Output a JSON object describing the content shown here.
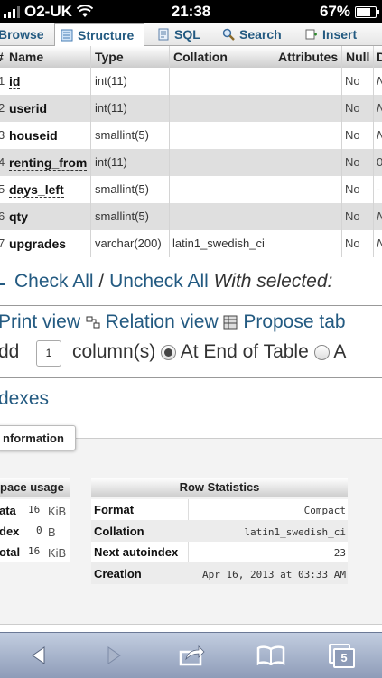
{
  "status": {
    "carrier": "O2-UK",
    "time": "21:38",
    "battery": "67%"
  },
  "tabs": [
    {
      "label": "Browse",
      "icon": "browse-icon"
    },
    {
      "label": "Structure",
      "icon": "structure-icon",
      "active": true
    },
    {
      "label": "SQL",
      "icon": "sql-icon"
    },
    {
      "label": "Search",
      "icon": "search-icon"
    },
    {
      "label": "Insert",
      "icon": "insert-icon"
    }
  ],
  "table": {
    "headers": {
      "num": "#",
      "name": "Name",
      "type": "Type",
      "collation": "Collation",
      "attributes": "Attributes",
      "null": "Null",
      "default": "D"
    },
    "rows": [
      {
        "num": "1",
        "name": "id",
        "type": "int(11)",
        "collation": "",
        "null": "No",
        "default": "N"
      },
      {
        "num": "2",
        "name": "userid",
        "type": "int(11)",
        "collation": "",
        "null": "No",
        "default": "N"
      },
      {
        "num": "3",
        "name": "houseid",
        "type": "smallint(5)",
        "collation": "",
        "null": "No",
        "default": "N"
      },
      {
        "num": "4",
        "name": "renting_from",
        "type": "int(11)",
        "collation": "",
        "null": "No",
        "default": "0"
      },
      {
        "num": "5",
        "name": "days_left",
        "type": "smallint(5)",
        "collation": "",
        "null": "No",
        "default": "-"
      },
      {
        "num": "6",
        "name": "qty",
        "type": "smallint(5)",
        "collation": "",
        "null": "No",
        "default": "N"
      },
      {
        "num": "7",
        "name": "upgrades",
        "type": "varchar(200)",
        "collation": "latin1_swedish_ci",
        "null": "No",
        "default": "N"
      }
    ]
  },
  "actions": {
    "check_all": "Check All",
    "slash": "/",
    "uncheck_all": "Uncheck All",
    "with_selected": "With selected:",
    "print_view": "Print view",
    "relation_view": "Relation view",
    "propose": "Propose tab",
    "add": "dd",
    "add_count": "1",
    "columns": "column(s)",
    "at_end": "At End of Table",
    "at_other": "A",
    "indexes": "dexes"
  },
  "info": {
    "tab_label": "nformation",
    "space": {
      "header": "pace usage",
      "rows": [
        {
          "label": "ata",
          "value": "16",
          "unit": "KiB"
        },
        {
          "label": "dex",
          "value": "0",
          "unit": "B"
        },
        {
          "label": "otal",
          "value": "16",
          "unit": "KiB"
        }
      ]
    },
    "rowstats": {
      "header": "Row Statistics",
      "rows": [
        {
          "label": "Format",
          "value": "Compact"
        },
        {
          "label": "Collation",
          "value": "latin1_swedish_ci"
        },
        {
          "label": "Next autoindex",
          "value": "23"
        },
        {
          "label": "Creation",
          "value": "Apr 16, 2013 at 03:33 AM"
        }
      ]
    }
  },
  "toolbar": {
    "tabs_count": "5"
  }
}
